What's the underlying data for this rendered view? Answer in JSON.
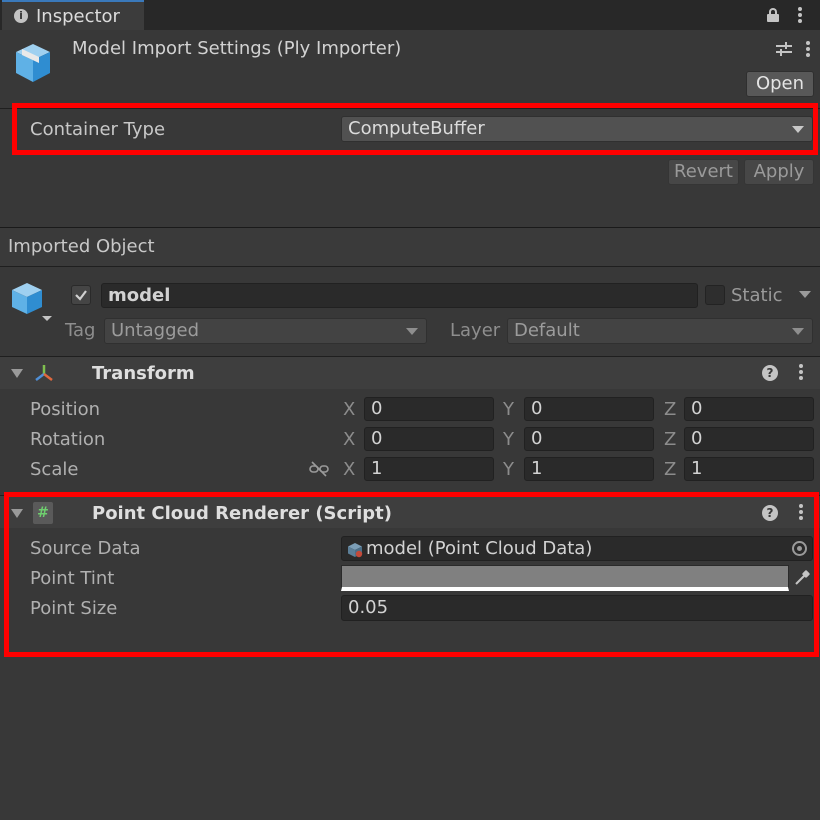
{
  "tab": {
    "label": "Inspector"
  },
  "header": {
    "title": "Model Import Settings (Ply Importer)",
    "open_label": "Open"
  },
  "container_type": {
    "label": "Container Type",
    "value": "ComputeBuffer"
  },
  "actions": {
    "revert_label": "Revert",
    "apply_label": "Apply"
  },
  "imported_object": {
    "section_label": "Imported Object"
  },
  "gameobject": {
    "active": true,
    "name": "model",
    "static_label": "Static",
    "tag_label": "Tag",
    "tag_value": "Untagged",
    "layer_label": "Layer",
    "layer_value": "Default"
  },
  "transform": {
    "title": "Transform",
    "position_label": "Position",
    "rotation_label": "Rotation",
    "scale_label": "Scale",
    "x_label": "X",
    "y_label": "Y",
    "z_label": "Z",
    "position": {
      "x": "0",
      "y": "0",
      "z": "0"
    },
    "rotation": {
      "x": "0",
      "y": "0",
      "z": "0"
    },
    "scale": {
      "x": "1",
      "y": "1",
      "z": "1"
    }
  },
  "point_cloud_renderer": {
    "title": "Point Cloud Renderer (Script)",
    "source_data_label": "Source Data",
    "source_data_value": "model (Point Cloud Data)",
    "point_tint_label": "Point Tint",
    "point_tint_color": "#808080",
    "point_size_label": "Point Size",
    "point_size_value": "0.05"
  },
  "colors": {
    "highlight": "#ff0000",
    "panel_bg": "#383838",
    "tab_accent": "#3a79bb"
  }
}
